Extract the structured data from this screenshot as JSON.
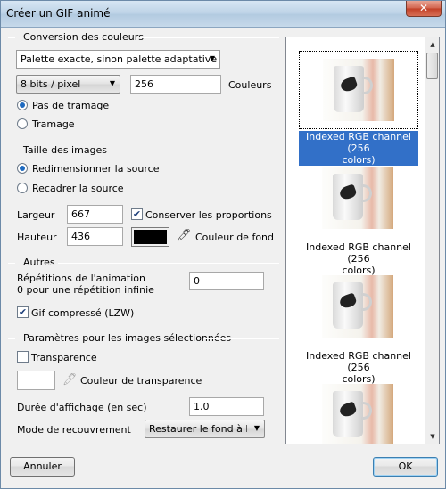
{
  "window": {
    "title": "Créer un GIF animé",
    "close_glyph": "✕"
  },
  "sections": {
    "colors": "Conversion des couleurs",
    "size": "Taille des images",
    "others": "Autres",
    "selected": "Paramètres pour les images sélectionnées"
  },
  "colors": {
    "palette_value": "Palette exacte, sinon palette adaptative",
    "bits_value": "8 bits / pixel",
    "colors_count": "256",
    "colors_label": "Couleurs",
    "no_dither": "Pas de tramage",
    "dither": "Tramage"
  },
  "size": {
    "resize": "Redimensionner la source",
    "crop": "Recadrer la source",
    "width_label": "Largeur",
    "width_value": "667",
    "height_label": "Hauteur",
    "height_value": "436",
    "keep_ratio": "Conserver les proportions",
    "bg_color_label": "Couleur de fond",
    "bg_color": "#000000"
  },
  "others": {
    "repeat_label_1": "Répétitions de l'animation",
    "repeat_label_2": "0 pour une répétition infinie",
    "repeat_value": "0",
    "lzw": "Gif compressé (LZW)"
  },
  "selected": {
    "transparency": "Transparence",
    "transparency_color_label": "Couleur de transparence",
    "duration_label": "Durée d'affichage (en sec)",
    "duration_value": "1.0",
    "overlay_label": "Mode de recouvrement",
    "overlay_value": "Restaurer le fond à l'affi"
  },
  "frames": [
    {
      "label_1": "Indexed RGB channel (256",
      "label_2": "colors)",
      "selected": true
    },
    {
      "label_1": "Indexed RGB channel (256",
      "label_2": "colors)",
      "selected": false
    },
    {
      "label_1": "Indexed RGB channel (256",
      "label_2": "colors)",
      "selected": false
    },
    {
      "label_1": "",
      "label_2": "",
      "selected": false
    }
  ],
  "buttons": {
    "cancel": "Annuler",
    "ok": "OK"
  },
  "icons": {
    "dropdown": "▼",
    "check": "✔",
    "picker": "🖊",
    "scroll_up": "▲",
    "scroll_down": "▼"
  },
  "accent_color": "#3270c8"
}
